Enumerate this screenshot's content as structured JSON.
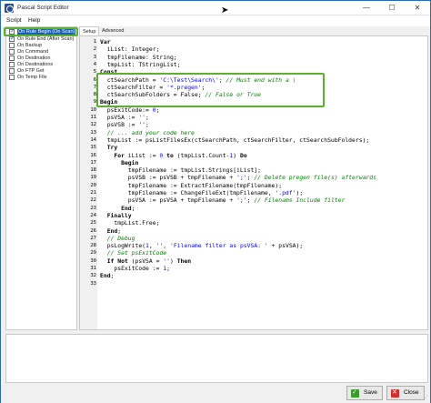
{
  "window": {
    "title": "Pascal Script Editor"
  },
  "menu": {
    "items": [
      "Script",
      "Help"
    ]
  },
  "events": [
    {
      "label": "On Rule Begin (On Scan)",
      "checked": true,
      "selected": true
    },
    {
      "label": "On Rule End (After Scan)",
      "checked": true,
      "selected": false
    },
    {
      "label": "On Backup",
      "checked": false,
      "selected": false
    },
    {
      "label": "On Command",
      "checked": false,
      "selected": false
    },
    {
      "label": "On Destination",
      "checked": false,
      "selected": false
    },
    {
      "label": "On Destinations",
      "checked": false,
      "selected": false
    },
    {
      "label": "On FTP Get",
      "checked": false,
      "selected": false
    },
    {
      "label": "On Temp File",
      "checked": false,
      "selected": false
    }
  ],
  "tabs": [
    "Setup",
    "Advanced"
  ],
  "editor": {
    "lines": [
      {
        "num": "1",
        "text": "Var"
      },
      {
        "num": "2",
        "text": "  iList: Integer;"
      },
      {
        "num": "3",
        "text": "  tmpFilename: String;"
      },
      {
        "num": "4",
        "text": "  tmpList: TStringList;"
      },
      {
        "num": "5",
        "text": "Const"
      },
      {
        "num": "6",
        "text": "  ctSearchPath = 'C:\\Test\\Search\\'; // Must end with a \\"
      },
      {
        "num": "7",
        "text": "  ctSearchFilter = '*.pregen';"
      },
      {
        "num": "8",
        "text": "  ctSearchSubFolders = False; // False or True"
      },
      {
        "num": "9",
        "text": "Begin"
      },
      {
        "num": "10",
        "text": "  psExitCode:= 0;"
      },
      {
        "num": "11",
        "text": "  psVSA := '';"
      },
      {
        "num": "12",
        "text": "  psVSB := '';"
      },
      {
        "num": "13",
        "text": "  // ... add your code here"
      },
      {
        "num": "14",
        "text": "  tmpList := psListFilesEx(ctSearchPath, ctSearchFilter, ctSearchSubFolders);"
      },
      {
        "num": "15",
        "text": "  Try"
      },
      {
        "num": "16",
        "text": "    For iList := 0 to (tmpList.Count-1) Do"
      },
      {
        "num": "17",
        "text": "      Begin"
      },
      {
        "num": "18",
        "text": "        tmpFilename := tmpList.Strings[iList];"
      },
      {
        "num": "19",
        "text": "        psVSB := psVSB + tmpFilename + ';'; // Delete pregen file(s) afterwards"
      },
      {
        "num": "20",
        "text": "        tmpFilename := ExtractFilename(tmpFilename);"
      },
      {
        "num": "21",
        "text": "        tmpFilename := ChangeFileExt(tmpFilename, '.pdf');"
      },
      {
        "num": "22",
        "text": "        psVSA := psVSA + tmpFilename + ';'; // Filenams Include filter"
      },
      {
        "num": "23",
        "text": "      End;"
      },
      {
        "num": "24",
        "text": "  Finally"
      },
      {
        "num": "25",
        "text": "    tmpList.Free;"
      },
      {
        "num": "26",
        "text": "  End;"
      },
      {
        "num": "27",
        "text": "  // Debug"
      },
      {
        "num": "28",
        "text": "  psLogWrite(1, '', 'Filename filter as psVSA: ' + psVSA);"
      },
      {
        "num": "29",
        "text": "  // Set psExitCode"
      },
      {
        "num": "30",
        "text": "  If Not (psVSA = '') Then"
      },
      {
        "num": "31",
        "text": "    psExitCode := 1;"
      },
      {
        "num": "32",
        "text": "End;"
      },
      {
        "num": "33",
        "text": ""
      }
    ]
  },
  "buttons": {
    "save": "Save",
    "close": "Close"
  },
  "colors": {
    "selection": "#1a5fb4",
    "highlight_outline": "#5cb030",
    "comment": "#008000",
    "string": "#0000ff"
  }
}
